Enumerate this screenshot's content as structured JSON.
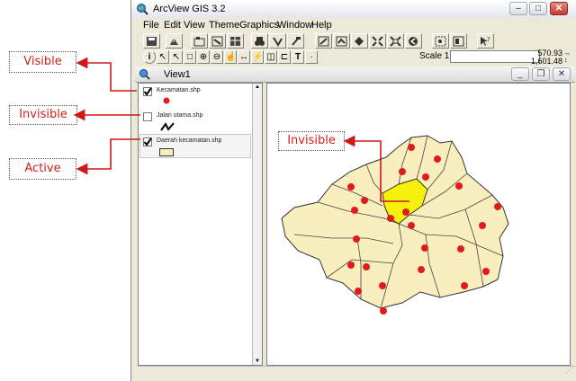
{
  "window": {
    "title": "ArcView GIS 3.2"
  },
  "menu": [
    "File",
    "Edit",
    "View",
    "Theme",
    "Graphics",
    "Window",
    "Help"
  ],
  "scale": {
    "label": "Scale 1:",
    "value": ""
  },
  "coords": {
    "x": "570.93",
    "y": "1,601.48"
  },
  "view": {
    "title": "View1"
  },
  "legend": [
    {
      "name": "Kecamatan.shp",
      "checked": true
    },
    {
      "name": "Jalan utama.shp",
      "checked": false
    },
    {
      "name": "Daerah kecamatan.shp",
      "checked": true
    }
  ],
  "annotations": {
    "visible": "Visible",
    "invisible_left": "Invisible",
    "active": "Active",
    "invisible_map": "Invisible"
  },
  "colors": {
    "polygon_fill": "#f9efbe",
    "polygon_highlight": "#f5f10a",
    "point": "#e11b1b",
    "annotation_text": "#d12020",
    "arrow": "#d01818"
  },
  "icons": {
    "app": "globe-magnifier-icon",
    "checked": "checkmark-icon",
    "road": "zigzag-line-icon"
  }
}
